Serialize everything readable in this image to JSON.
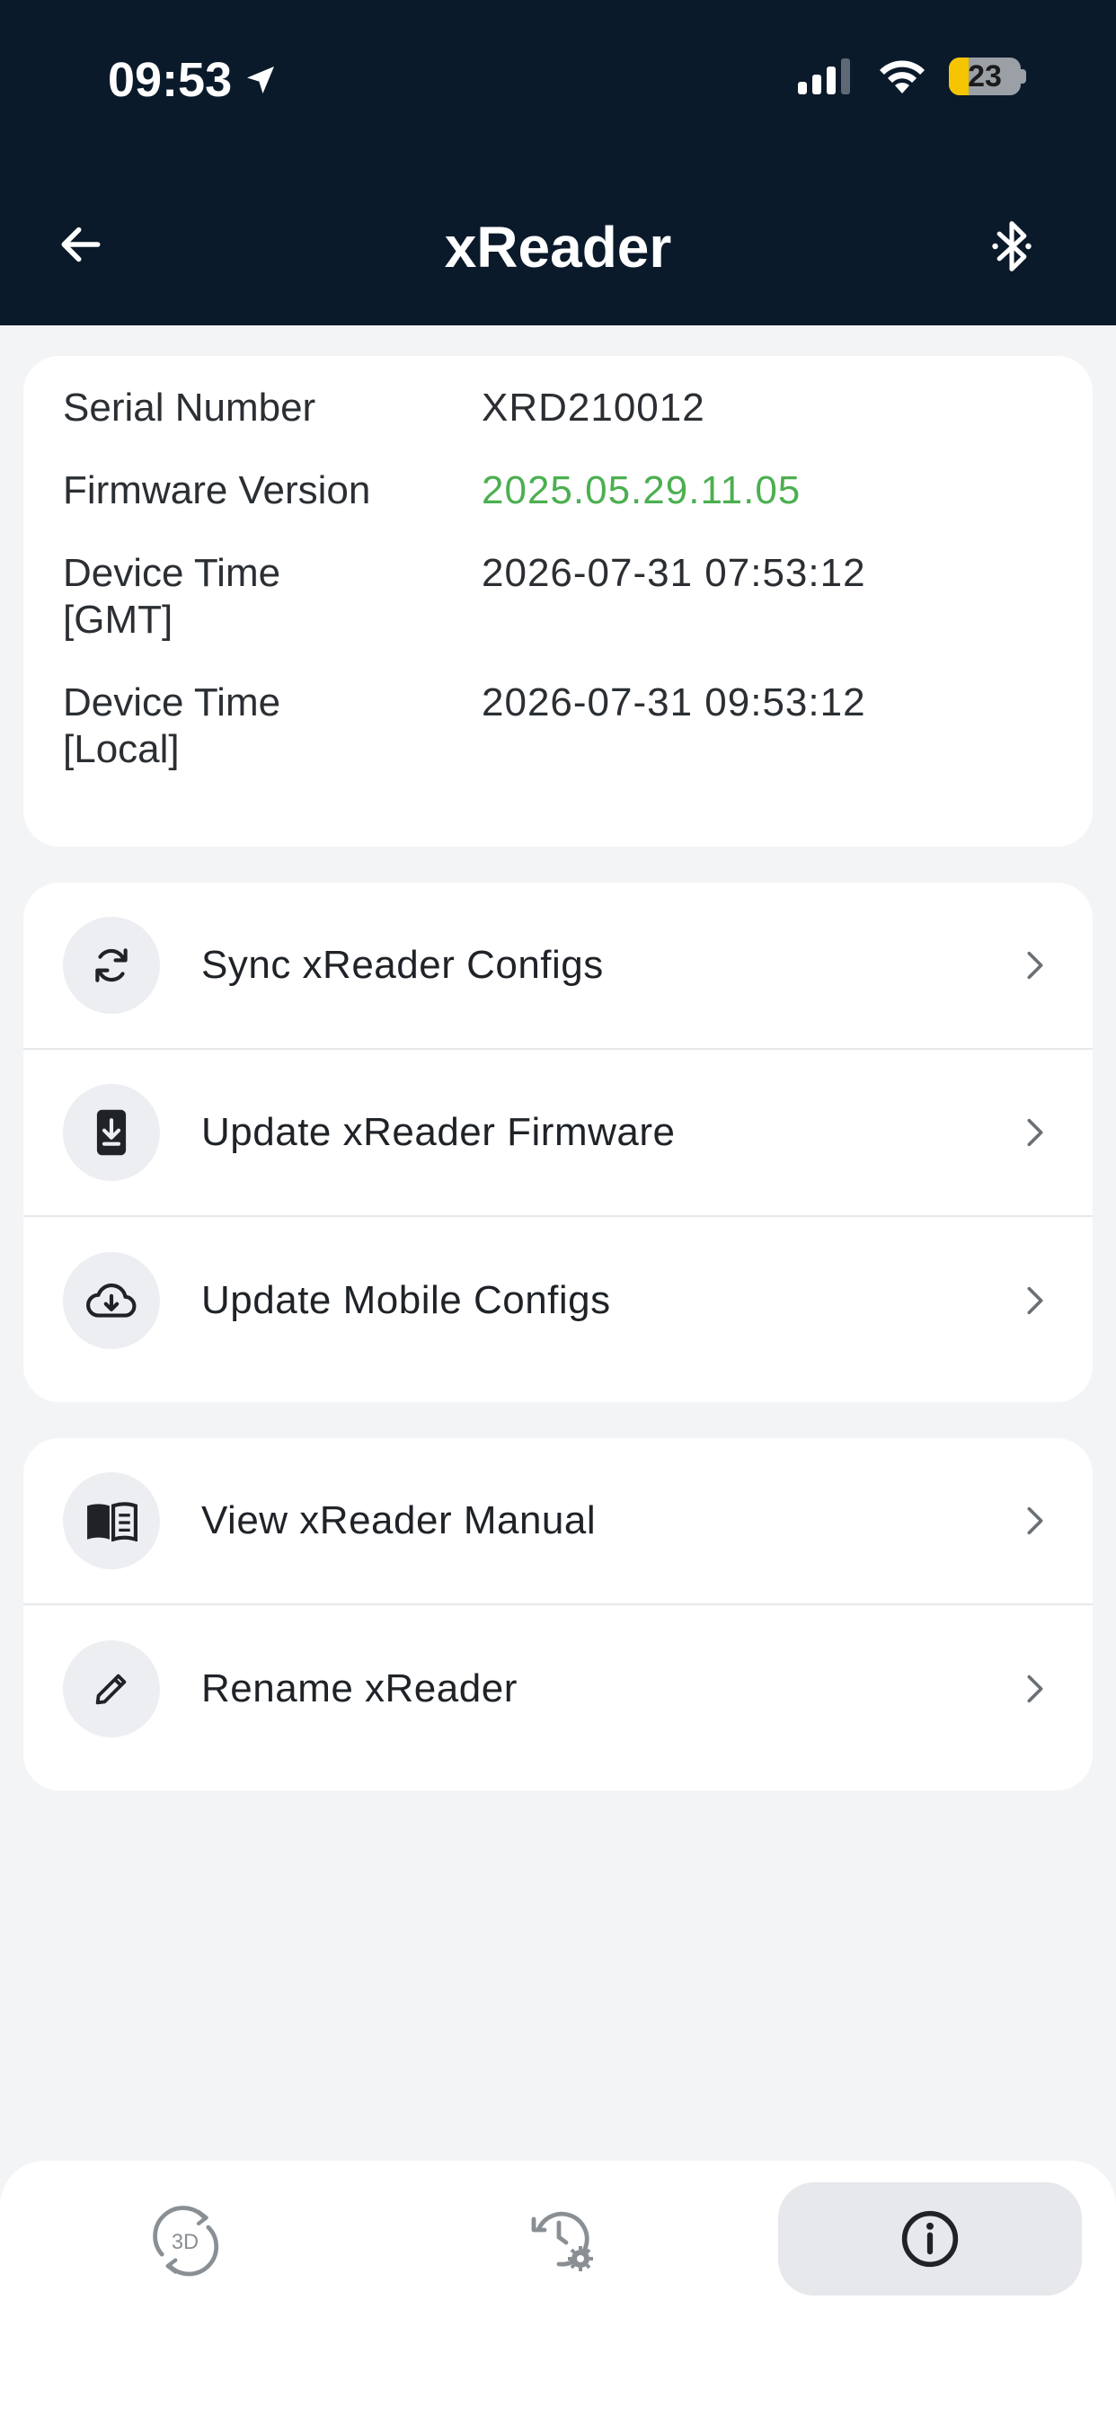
{
  "status_bar": {
    "time": "09:53",
    "battery_level": "23",
    "icons": [
      "location-arrow-icon",
      "cellular-signal-icon",
      "wifi-icon",
      "battery-icon"
    ]
  },
  "nav": {
    "title": "xReader",
    "back_icon": "arrow-left-icon",
    "right_icon": "bluetooth-icon"
  },
  "device_info": {
    "rows": [
      {
        "label": "Serial Number",
        "value": "XRD210012"
      },
      {
        "label": "Firmware Version",
        "value": "2025.05.29.11.05"
      },
      {
        "label": "Device Time\n[GMT]",
        "value": "2026-07-31 07:53:12"
      },
      {
        "label": "Device Time\n[Local]",
        "value": "2026-07-31 09:53:12"
      }
    ],
    "firmware_color": "#4caf50"
  },
  "menu_group_1": [
    {
      "label": "Sync xReader Configs",
      "icon": "sync-icon"
    },
    {
      "label": "Update xReader Firmware",
      "icon": "device-download-icon"
    },
    {
      "label": "Update Mobile Configs",
      "icon": "cloud-download-icon"
    }
  ],
  "menu_group_2": [
    {
      "label": "View xReader Manual",
      "icon": "book-icon"
    },
    {
      "label": "Rename xReader",
      "icon": "pencil-icon"
    }
  ],
  "bottom_tabs": {
    "items": [
      {
        "name": "3d-tab",
        "icon": "3d-rotate-icon",
        "selected": false,
        "icon_text": "3D"
      },
      {
        "name": "history-settings-tab",
        "icon": "history-settings-icon",
        "selected": false
      },
      {
        "name": "info-tab",
        "icon": "info-icon",
        "selected": true
      }
    ]
  },
  "colors": {
    "header_bg": "#0a1a2b",
    "page_bg": "#f3f4f6",
    "accent_green": "#4caf50",
    "battery_yellow": "#f4c500"
  }
}
